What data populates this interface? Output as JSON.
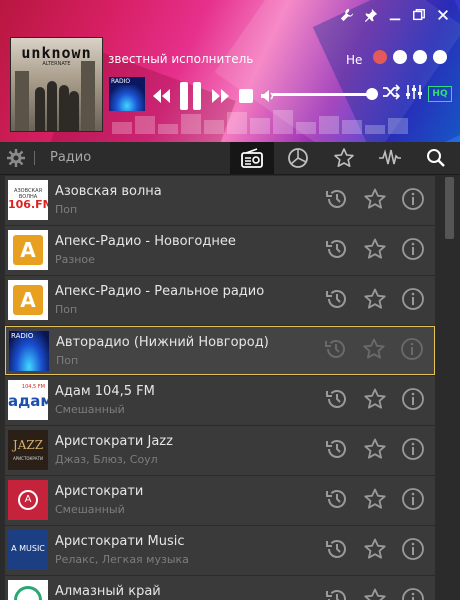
{
  "header": {
    "album_logo": "unknown",
    "album_sub": "ALTERNATE",
    "artist": "звестный исполнитель",
    "service_label": "Не",
    "hq_label": "HQ",
    "thumb_label": "RADIO"
  },
  "toolbar": {
    "title": "Радио"
  },
  "stations": [
    {
      "name": "Азовская волна",
      "genre": "Поп",
      "logo_text": "АЗОВСКАЯ ВОЛНА",
      "logo_sub": "106.FM",
      "selected": false
    },
    {
      "name": "Апекс-Радио - Новогоднее",
      "genre": "Разное",
      "logo_text": "A",
      "selected": false
    },
    {
      "name": "Апекс-Радио - Реальное радио",
      "genre": "Поп",
      "logo_text": "A",
      "selected": false
    },
    {
      "name": "Авторадио (Нижний Новгород)",
      "genre": "Поп",
      "logo_text": "RADIO",
      "selected": true
    },
    {
      "name": "Адам 104,5 FM",
      "genre": "Смешанный",
      "logo_text": "адам",
      "logo_sub": "104,5 FM",
      "selected": false
    },
    {
      "name": "Аристократи Jazz",
      "genre": "Джаз, Блюз, Соул",
      "logo_text": "JAZZ",
      "logo_sub": "АРИСТОКРАТИ",
      "selected": false
    },
    {
      "name": "Аристократи",
      "genre": "Смешанный",
      "logo_text": "A",
      "selected": false
    },
    {
      "name": "Аристократи Music",
      "genre": "Релакс, Легкая музыка",
      "logo_text": "A MUSIC",
      "selected": false
    },
    {
      "name": "Алмазный край",
      "genre": "",
      "logo_text": "",
      "selected": false
    }
  ],
  "colors": {
    "selected_border": "#e6c25a",
    "hq": "#2fe07a",
    "rec": "#e25a5a"
  }
}
